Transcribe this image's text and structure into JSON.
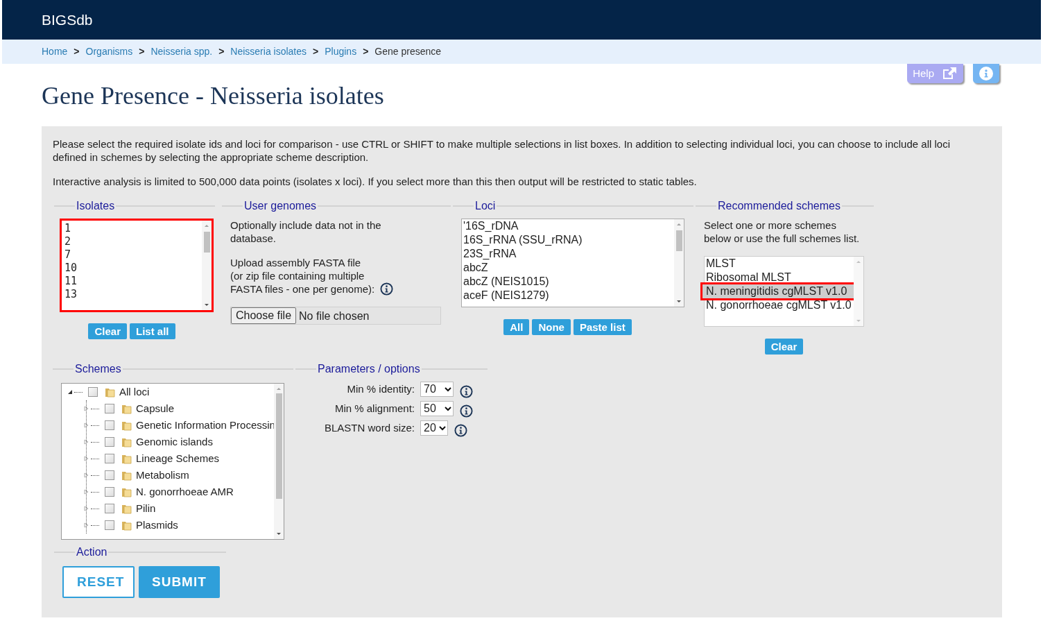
{
  "header": {
    "brand": "BIGSdb"
  },
  "breadcrumb": [
    {
      "label": "Home",
      "kind": "link"
    },
    {
      "prefix": ">",
      "label": "Organisms",
      "kind": "link"
    },
    {
      "prefix": ">",
      "label": "Neisseria spp.",
      "kind": "link"
    },
    {
      "prefix": ">",
      "label": "Neisseria isolates",
      "kind": "link"
    },
    {
      "prefix": ">",
      "label": "Plugins",
      "kind": "link"
    },
    {
      "prefix": ">",
      "label": "Gene presence",
      "kind": "current"
    }
  ],
  "help_button": {
    "label": "Help"
  },
  "title": "Gene Presence - Neisseria isolates",
  "intro": [
    "Please select the required isolate ids and loci for comparison - use CTRL or SHIFT to make multiple selections in list boxes. In addition to selecting individual loci, you can choose to include all loci defined in schemes by selecting the appropriate scheme description.",
    "Interactive analysis is limited to 500,000 data points (isolates x loci). If you select more than this then output will be restricted to static tables."
  ],
  "isolates": {
    "legend": "Isolates",
    "highlighted": true,
    "items": [
      {
        "label": "1",
        "selected": false
      },
      {
        "label": "2",
        "selected": false
      },
      {
        "label": "7",
        "selected": false
      },
      {
        "label": "10",
        "selected": false
      },
      {
        "label": "11",
        "selected": false
      },
      {
        "label": "13",
        "selected": false
      }
    ],
    "buttons": [
      "Clear",
      "List all"
    ]
  },
  "user_genomes": {
    "legend": "User genomes",
    "note": "Optionally include data not in the database.",
    "upload_lines": [
      "Upload assembly FASTA file",
      "(or zip file containing multiple",
      "FASTA files - one per genome):"
    ],
    "file_button": "Choose file",
    "file_status": "No file chosen"
  },
  "loci": {
    "legend": "Loci",
    "items": [
      {
        "label": "'16S_rDNA",
        "selected": false
      },
      {
        "label": "16S_rRNA (SSU_rRNA)",
        "selected": false
      },
      {
        "label": "23S_rRNA",
        "selected": false
      },
      {
        "label": "abcZ",
        "selected": false
      },
      {
        "label": "abcZ (NEIS1015)",
        "selected": false
      },
      {
        "label": "aceF (NEIS1279)",
        "selected": false
      }
    ],
    "buttons": [
      "All",
      "None",
      "Paste list"
    ]
  },
  "recommended_schemes": {
    "legend": "Recommended schemes",
    "note_lines": [
      "Select one or more schemes",
      "below or use the full schemes list."
    ],
    "items": [
      {
        "label": "MLST",
        "selected": false
      },
      {
        "label": "Ribosomal MLST",
        "selected": false
      },
      {
        "label": "N. meningitidis cgMLST v1.0",
        "selected": true
      },
      {
        "label": "N. gonorrhoeae cgMLST v1.0",
        "selected": false
      }
    ],
    "button": "Clear"
  },
  "schemes": {
    "legend": "Schemes",
    "tree": [
      {
        "label": "All loci",
        "expanded": true,
        "checked": false,
        "children": [
          {
            "label": "Capsule",
            "expanded": false,
            "checked": false
          },
          {
            "label": "Genetic Information Processin",
            "expanded": false,
            "checked": false
          },
          {
            "label": "Genomic islands",
            "expanded": false,
            "checked": false
          },
          {
            "label": "Lineage Schemes",
            "expanded": false,
            "checked": false
          },
          {
            "label": "Metabolism",
            "expanded": false,
            "checked": false
          },
          {
            "label": "N. gonorrhoeae AMR",
            "expanded": false,
            "checked": false
          },
          {
            "label": "Pilin",
            "expanded": false,
            "checked": false
          },
          {
            "label": "Plasmids",
            "expanded": false,
            "checked": false
          }
        ]
      }
    ]
  },
  "parameters": {
    "legend": "Parameters / options",
    "fields": [
      {
        "label": "Min % identity:",
        "value": "70"
      },
      {
        "label": "Min % alignment:",
        "value": "50"
      },
      {
        "label": "BLASTN word size:",
        "value": "20"
      }
    ]
  },
  "action": {
    "legend": "Action",
    "buttons": [
      {
        "label": "RESET",
        "kind": "secondary"
      },
      {
        "label": "SUBMIT",
        "kind": "primary"
      }
    ]
  }
}
